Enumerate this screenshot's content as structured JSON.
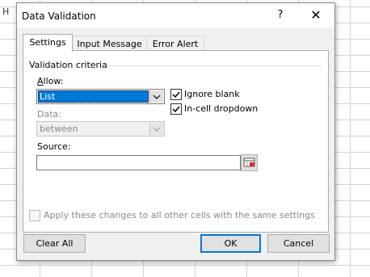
{
  "sheet": {
    "cell_fragment": "H"
  },
  "window": {
    "title": "Data Validation",
    "help_label": "?",
    "close_label": "✕"
  },
  "tabs": [
    {
      "label": "Settings"
    },
    {
      "label": "Input Message"
    },
    {
      "label": "Error Alert"
    }
  ],
  "settings": {
    "group_title": "Validation criteria",
    "allow": {
      "label": "Allow:",
      "value": "List"
    },
    "data": {
      "label": "Data:",
      "value": "between"
    },
    "ignore_blank": {
      "label": "Ignore blank",
      "checked": true
    },
    "in_cell_dropdown": {
      "label": "In-cell dropdown",
      "checked": true
    },
    "source": {
      "label": "Source:",
      "value": ""
    },
    "apply_all": {
      "label": "Apply these changes to all other cells with the same settings",
      "checked": false
    }
  },
  "buttons": {
    "clear_all": "Clear All",
    "ok": "OK",
    "cancel": "Cancel"
  },
  "colors": {
    "selection": "#0078d7",
    "dialog_bg": "#f0f0f0",
    "button_bg": "#e1e1e1"
  }
}
